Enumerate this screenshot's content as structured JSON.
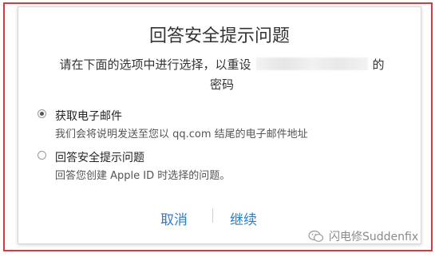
{
  "dialog": {
    "title": "回答安全提示问题",
    "subtitle_before": "请在下面的选项中进行选择，以重设",
    "subtitle_after": "的",
    "subtitle_line2": "密码"
  },
  "options": [
    {
      "label": "获取电子邮件",
      "description": "我们会将说明发送至您以 qq.com 结尾的电子邮件地址",
      "selected": true
    },
    {
      "label": "回答安全提示问题",
      "description": "回答您创建 Apple ID 时选择的问题。",
      "selected": false
    }
  ],
  "buttons": {
    "cancel": "取消",
    "continue": "继续"
  },
  "watermark": {
    "text": "闪电修Suddenfix",
    "icon": "wechat-icon"
  },
  "colors": {
    "frame_border": "#e0363a",
    "link": "#2a7dc9"
  }
}
